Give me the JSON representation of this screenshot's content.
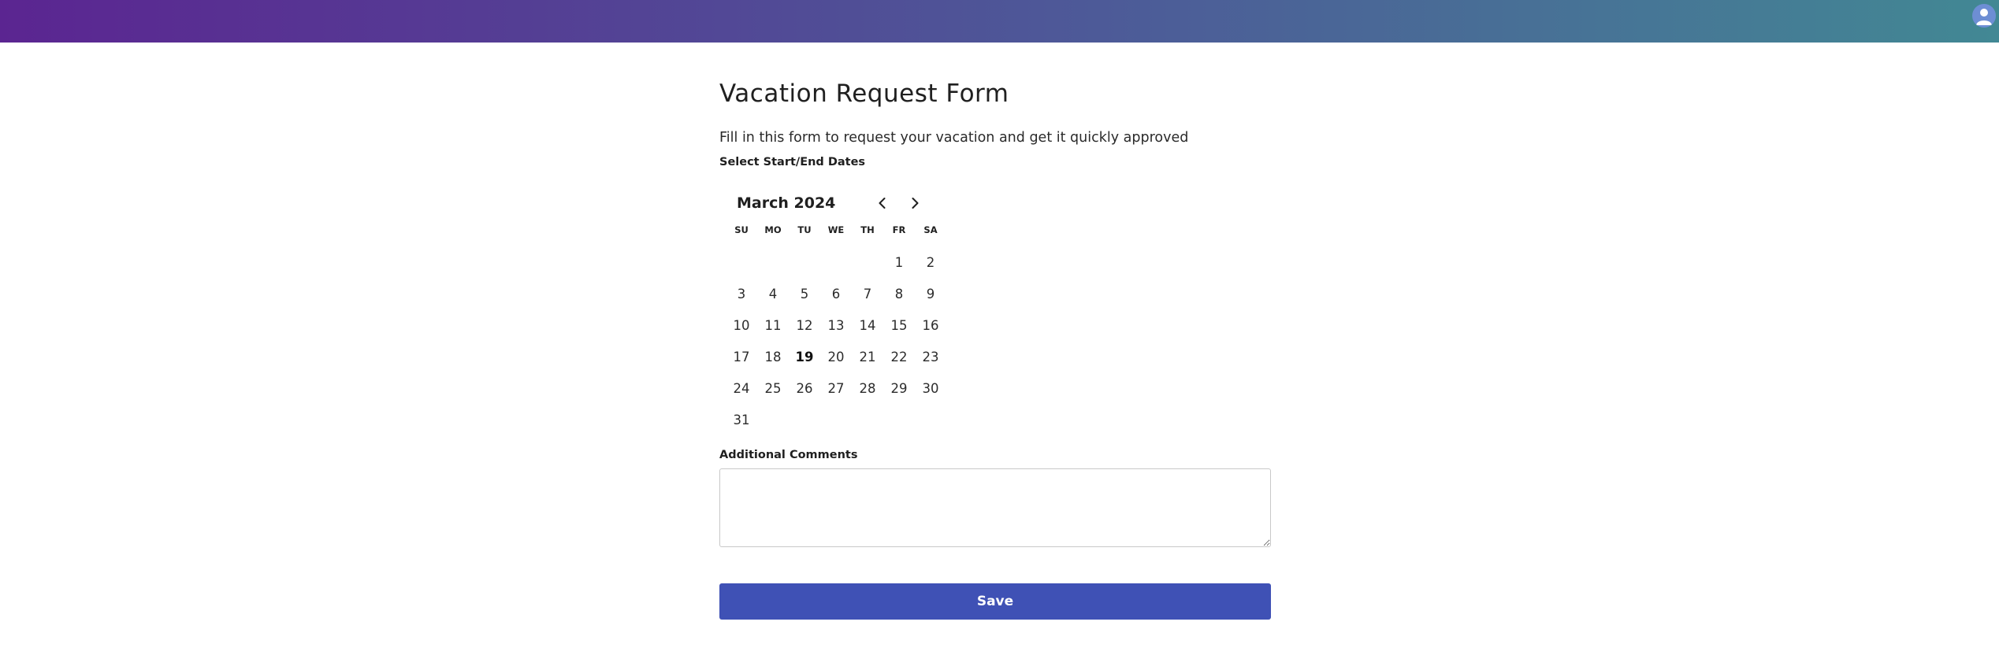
{
  "header": {
    "gradient_start": "#5b2591",
    "gradient_end": "#428894",
    "avatar_icon": "user-icon"
  },
  "form": {
    "title": "Vacation Request Form",
    "subtitle": "Fill in this form to request your vacation and get it quickly approved",
    "dates_label": "Select Start/End Dates",
    "comments_label": "Additional Comments",
    "comments_value": "",
    "save_label": "Save"
  },
  "calendar": {
    "month_label": "March 2024",
    "prev_icon": "chevron-left-icon",
    "next_icon": "chevron-right-icon",
    "weekdays": [
      "SU",
      "MO",
      "TU",
      "WE",
      "TH",
      "FR",
      "SA"
    ],
    "leading_blanks": 5,
    "days": [
      "1",
      "2",
      "3",
      "4",
      "5",
      "6",
      "7",
      "8",
      "9",
      "10",
      "11",
      "12",
      "13",
      "14",
      "15",
      "16",
      "17",
      "18",
      "19",
      "20",
      "21",
      "22",
      "23",
      "24",
      "25",
      "26",
      "27",
      "28",
      "29",
      "30",
      "31"
    ],
    "today": "19"
  },
  "colors": {
    "accent": "#3f51b5",
    "avatar_bg": "#6d8ed4"
  }
}
